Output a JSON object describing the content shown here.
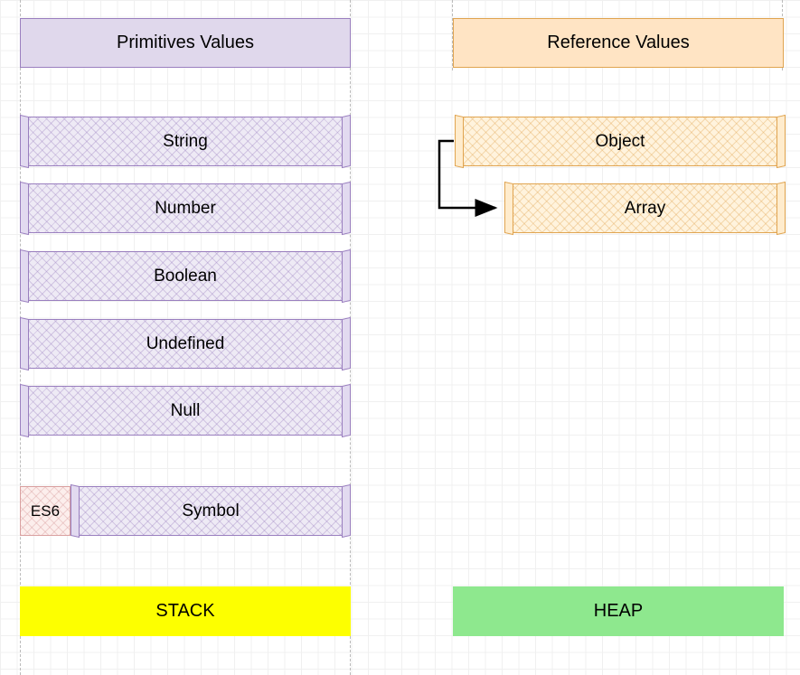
{
  "left": {
    "header": "Primitives Values",
    "items": [
      "String",
      "Number",
      "Boolean",
      "Undefined",
      "Null",
      "Symbol"
    ],
    "tag": "ES6",
    "footer": "STACK"
  },
  "right": {
    "header": "Reference Values",
    "items": [
      "Object",
      "Array"
    ],
    "footer": "HEAP"
  },
  "colors": {
    "purple_fill": "#eeeaf5",
    "purple_border": "#9a7fbf",
    "orange_fill": "#fff3dd",
    "orange_border": "#e0a450",
    "yellow": "#fdff00",
    "green": "#8ee88e"
  }
}
